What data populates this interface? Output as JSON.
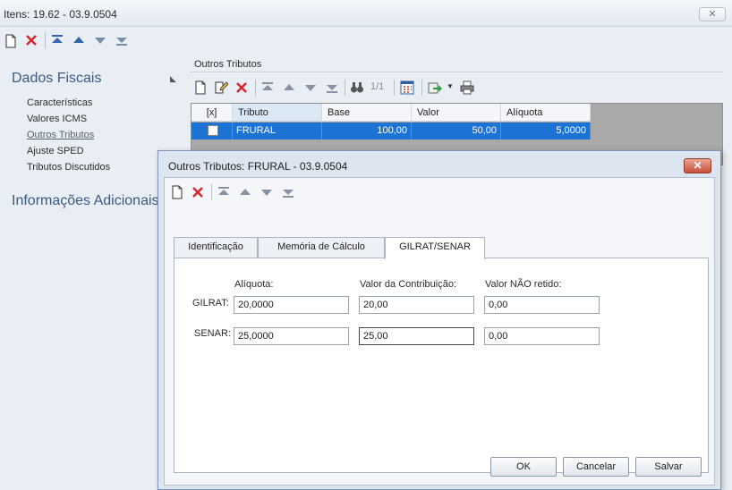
{
  "window": {
    "title": "Itens: 19.62 - 03.9.0504",
    "close_label": "✕"
  },
  "nav": {
    "sections": [
      "Dados Fiscais",
      "Informações Adicionais"
    ],
    "items": [
      "Características",
      "Valores ICMS",
      "Outros Tributos",
      "Ajuste SPED",
      "Tributos Discutidos"
    ],
    "active_item": "Outros Tributos"
  },
  "outros_tributos": {
    "group_title": "Outros Tributos",
    "page_indicator": "1/1",
    "columns": [
      "[x]",
      "Tributo",
      "Base",
      "Valor",
      "Alíquota"
    ],
    "rows": [
      {
        "checked": false,
        "tributo": "FRURAL",
        "base": "100,00",
        "valor": "50,00",
        "aliquota": "5,0000"
      }
    ]
  },
  "dialog": {
    "title": "Outros Tributos: FRURAL - 03.9.0504",
    "close_label": "✕",
    "tabs": [
      "Identificação",
      "Memória de Cálculo",
      "GILRAT/SENAR"
    ],
    "active_tab": "GILRAT/SENAR",
    "column_labels": [
      "Alíquota:",
      "Valor da Contribuição:",
      "Valor NÃO retido:"
    ],
    "rows": [
      {
        "label": "GILRAT:",
        "aliquota": "20,0000",
        "valor_contribuicao": "20,00",
        "valor_nao_retido": "0,00"
      },
      {
        "label": "SENAR:",
        "aliquota": "25,0000",
        "valor_contribuicao": "25,00",
        "valor_nao_retido": "0,00"
      }
    ],
    "buttons": {
      "ok": "OK",
      "cancel": "Cancelar",
      "save": "Salvar"
    }
  },
  "colors": {
    "selection": "#1d73d4",
    "section_title": "#3b5a80",
    "close_red": "#c8503a"
  }
}
